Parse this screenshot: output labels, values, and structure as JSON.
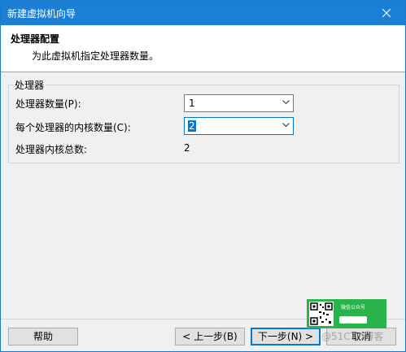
{
  "window": {
    "title": "新建虚拟机向导"
  },
  "header": {
    "title": "处理器配置",
    "subtitle": "为此虚拟机指定处理器数量。"
  },
  "processor_group": {
    "label": "处理器",
    "processor_count_label": "处理器数量(P):",
    "processor_count_value": "1",
    "cores_per_processor_label": "每个处理器的内核数量(C):",
    "cores_per_processor_value": "2",
    "total_cores_label": "处理器内核总数:",
    "total_cores_value": "2"
  },
  "buttons": {
    "help": "帮助",
    "back": "< 上一步(B)",
    "next": "下一步(N) >",
    "cancel": "取消"
  },
  "overlay": {
    "wechat_label": "微信公众号",
    "watermark": "@51CTO博客"
  },
  "colors": {
    "titlebar": "#1c7fd6",
    "focus": "#0078d7",
    "overlay": "#29b34a"
  }
}
